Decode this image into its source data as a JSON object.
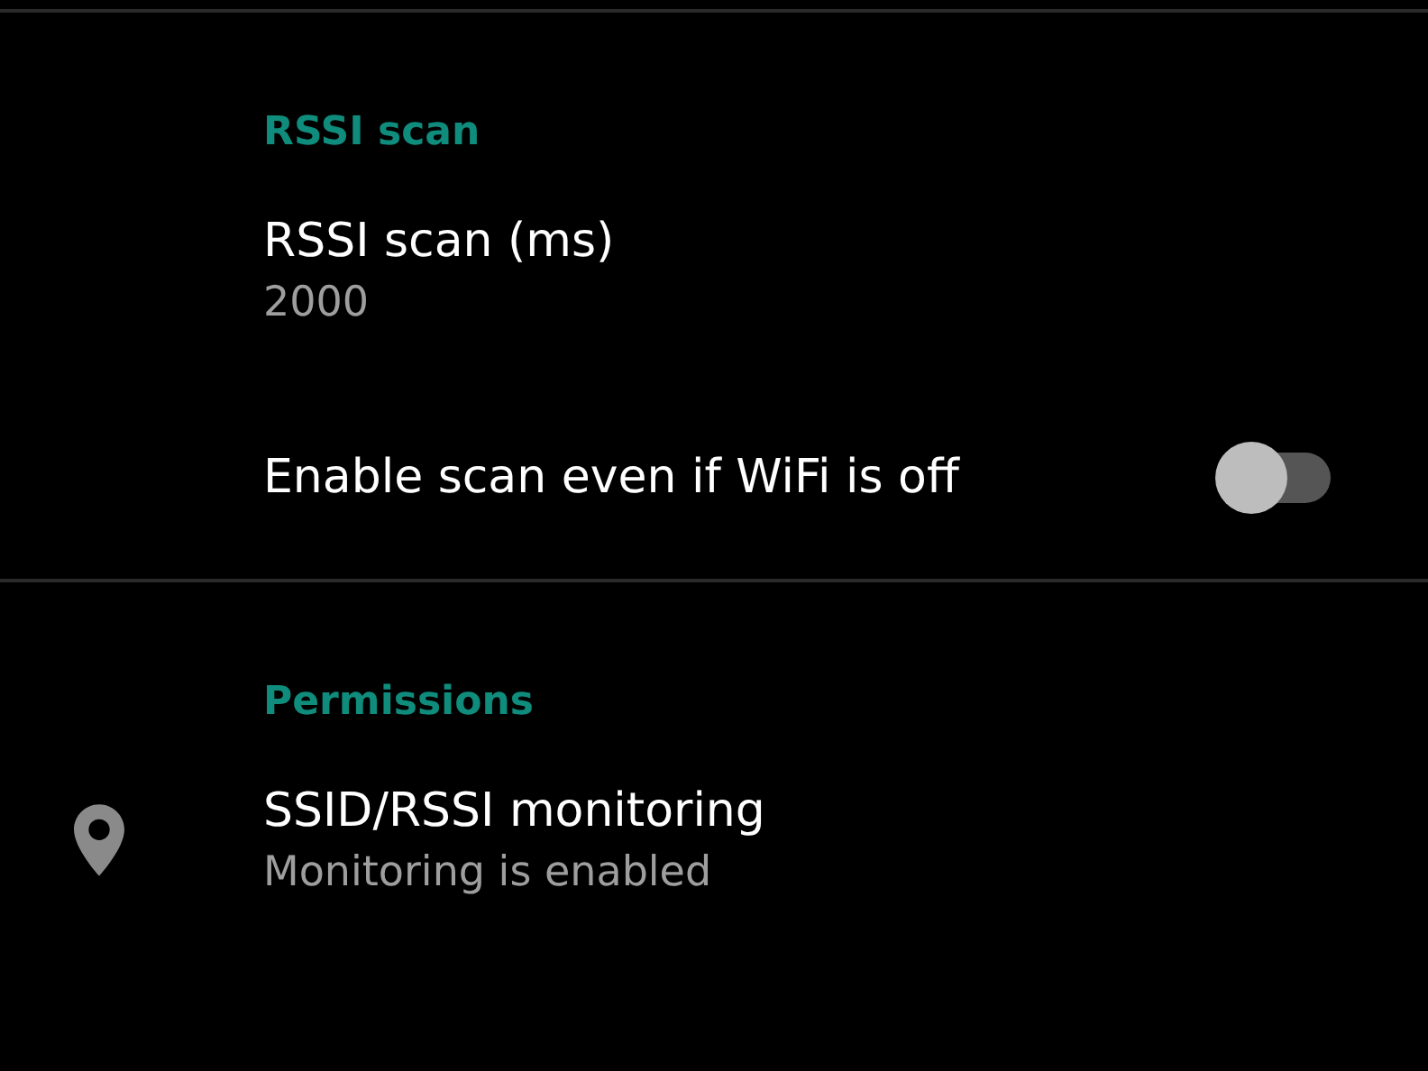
{
  "sections": [
    {
      "header": "RSSI scan",
      "items": [
        {
          "kind": "text",
          "title": "RSSI scan (ms)",
          "summary": "2000"
        },
        {
          "kind": "switch",
          "title": "Enable scan even if WiFi is off",
          "on": false
        }
      ]
    },
    {
      "header": "Permissions",
      "items": [
        {
          "kind": "location",
          "title": "SSID/RSSI monitoring",
          "summary": "Monitoring is enabled"
        }
      ]
    }
  ]
}
